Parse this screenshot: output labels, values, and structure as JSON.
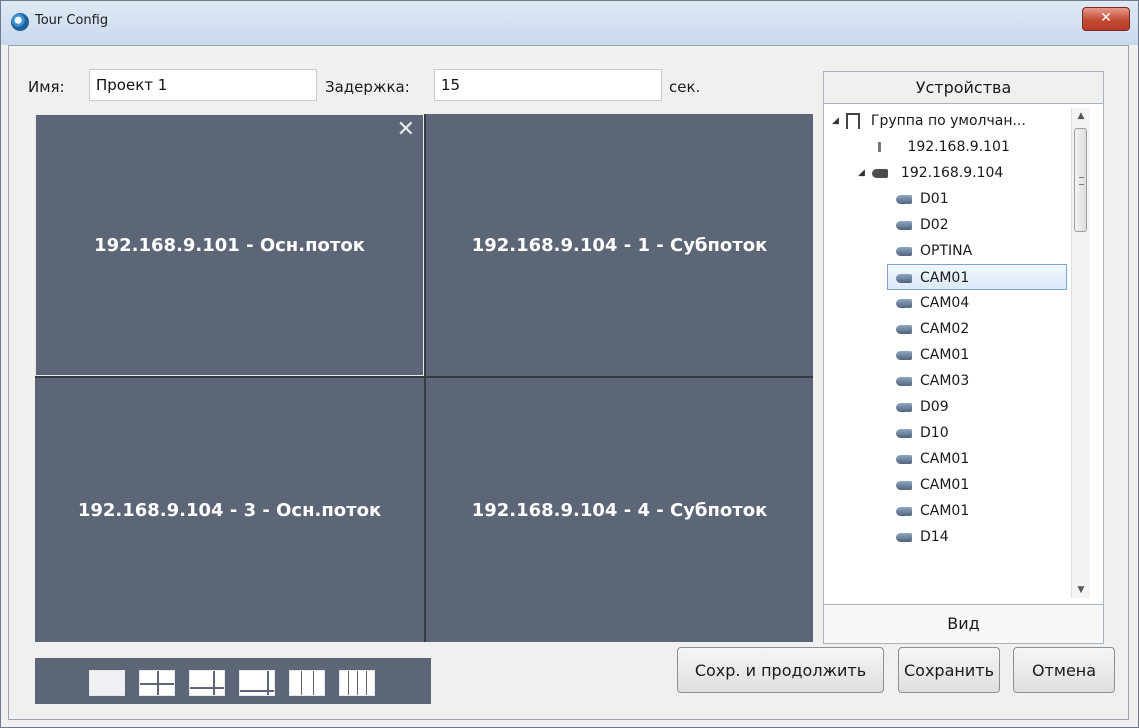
{
  "window": {
    "title": "Tour Config",
    "close_glyph": "✕"
  },
  "form": {
    "name_label": "Имя:",
    "name_value": "Проект 1",
    "delay_label": "Задержка:",
    "delay_value": "15",
    "delay_unit": "сек."
  },
  "grid": {
    "cells": [
      {
        "label": "192.168.9.101 - Осн.поток",
        "selected": true
      },
      {
        "label": "192.168.9.104 - 1 - Субпоток"
      },
      {
        "label": "192.168.9.104 - 3 - Осн.поток"
      },
      {
        "label": "192.168.9.104 - 4 - Субпоток"
      }
    ],
    "close_glyph": "✕"
  },
  "layouts": [
    "1x1",
    "2x2",
    "1+5",
    "1+7",
    "3x3",
    "4x4"
  ],
  "devices": {
    "header": "Устройства",
    "group": "Группа по умолчан...",
    "nodes": [
      {
        "label": "192.168.9.101",
        "type": "ipc"
      },
      {
        "label": "192.168.9.104",
        "type": "nvr",
        "expanded": true
      },
      {
        "label": "D01",
        "type": "cam"
      },
      {
        "label": "D02",
        "type": "cam"
      },
      {
        "label": "OPTINA",
        "type": "cam"
      },
      {
        "label": "CAM01",
        "type": "cam",
        "selected": true
      },
      {
        "label": "CAM04",
        "type": "cam"
      },
      {
        "label": "CAM02",
        "type": "cam"
      },
      {
        "label": "CAM01",
        "type": "cam"
      },
      {
        "label": "CAM03",
        "type": "cam"
      },
      {
        "label": "D09",
        "type": "cam"
      },
      {
        "label": "D10",
        "type": "cam"
      },
      {
        "label": "CAM01",
        "type": "cam"
      },
      {
        "label": "CAM01",
        "type": "cam"
      },
      {
        "label": "CAM01",
        "type": "cam"
      },
      {
        "label": "D14",
        "type": "cam"
      }
    ],
    "view_button": "Вид"
  },
  "buttons": {
    "save_continue": "Сохр. и продолжить",
    "save": "Сохранить",
    "cancel": "Отмена"
  },
  "colors": {
    "cell_bg": "#5d6677",
    "grid_lines": "#363a42",
    "highlight": "#7da2ce"
  }
}
